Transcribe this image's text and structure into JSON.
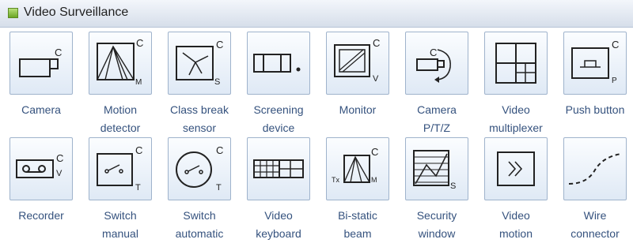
{
  "panel": {
    "title": "Video Surveillance"
  },
  "shapes": [
    {
      "icon": "camera-icon",
      "label1": "Camera",
      "label2": ""
    },
    {
      "icon": "motion-detector-icon",
      "label1": "Motion",
      "label2": "detector"
    },
    {
      "icon": "class-break-sensor-icon",
      "label1": "Class break",
      "label2": "sensor"
    },
    {
      "icon": "screening-device-icon",
      "label1": "Screening",
      "label2": "device"
    },
    {
      "icon": "monitor-icon",
      "label1": "Monitor",
      "label2": ""
    },
    {
      "icon": "camera-ptz-icon",
      "label1": "Camera",
      "label2": "P/T/Z"
    },
    {
      "icon": "video-multiplexer-icon",
      "label1": "Video",
      "label2": "multiplexer"
    },
    {
      "icon": "push-button-icon",
      "label1": "Push button",
      "label2": ""
    },
    {
      "icon": "recorder-icon",
      "label1": "Recorder",
      "label2": ""
    },
    {
      "icon": "switch-manual-icon",
      "label1": "Switch",
      "label2": "manual"
    },
    {
      "icon": "switch-automatic-icon",
      "label1": "Switch",
      "label2": "automatic"
    },
    {
      "icon": "video-keyboard-icon",
      "label1": "Video",
      "label2": "keyboard"
    },
    {
      "icon": "bi-static-beam-icon",
      "label1": "Bi-static",
      "label2": "beam"
    },
    {
      "icon": "security-window-icon",
      "label1": "Security",
      "label2": "window"
    },
    {
      "icon": "video-motion-icon",
      "label1": "Video",
      "label2": "motion"
    },
    {
      "icon": "wire-connector-icon",
      "label1": "Wire",
      "label2": "connector"
    }
  ],
  "glyphs": {
    "c": "C",
    "m": "M",
    "s": "S",
    "v": "V",
    "t": "T",
    "p": "P",
    "tx": "Tx"
  }
}
